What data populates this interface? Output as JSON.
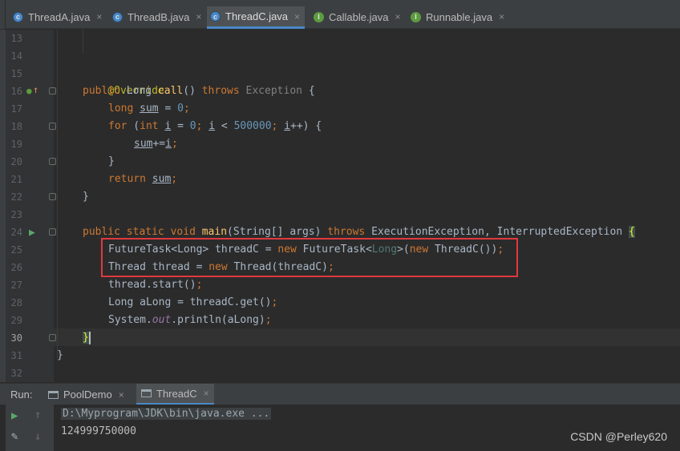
{
  "tabs": [
    {
      "label": "ThreadA.java",
      "icon": "class-icon",
      "active": false
    },
    {
      "label": "ThreadB.java",
      "icon": "class-icon",
      "active": false
    },
    {
      "label": "ThreadC.java",
      "icon": "class-icon",
      "active": true
    },
    {
      "label": "Callable.java",
      "icon": "interface-icon",
      "active": false
    },
    {
      "label": "Runnable.java",
      "icon": "interface-icon",
      "active": false
    }
  ],
  "close_glyph": "×",
  "line_numbers": [
    "13",
    "14",
    "15",
    "16",
    "17",
    "18",
    "19",
    "20",
    "21",
    "22",
    "23",
    "24",
    "25",
    "26",
    "27",
    "28",
    "29",
    "30",
    "31",
    "32"
  ],
  "current_line": "30",
  "code": {
    "annotation": "@Override",
    "public": "public",
    "long_type": "Long",
    "call": "call",
    "parens": "()",
    "throws": "throws",
    "exception": "Exception",
    "open_brace": "{",
    "long_kw": "long",
    "sum": "sum",
    "eq": " = ",
    "zero": "0",
    "semi": ";",
    "for": "for",
    "int": "int",
    "i": "i",
    "lt": " < ",
    "limit": "500000",
    "inc": "++",
    "sum_add": "+=",
    "close_brace": "}",
    "return": "return",
    "static": "static",
    "void": "void",
    "main": "main",
    "main_args": "(String[] args) ",
    "exceptions_main": "ExecutionException, InterruptedException ",
    "futuretask": "FutureTask",
    "lt_gen": "<",
    "gt_gen": ">",
    "threadc_var": " threadC = ",
    "new": "new",
    "threadc_ctor": "ThreadC()",
    "thread_decl": "Thread thread = ",
    "thread_ctor": " Thread(threadC)",
    "thread_start": "thread.start()",
    "along_decl": "Long aLong = threadC.get()",
    "system": "System.",
    "out": "out",
    "println": ".println(aLong)"
  },
  "run": {
    "label": "Run:",
    "tabs": [
      {
        "label": "PoolDemo",
        "active": false
      },
      {
        "label": "ThreadC",
        "active": true
      }
    ],
    "console_lines": [
      "D:\\Myprogram\\JDK\\bin\\java.exe ...",
      "124999750000"
    ]
  },
  "watermark": "CSDN @Perley620",
  "colors": {
    "accent": "#4a88c7",
    "highlight_box": "#e0393e",
    "keyword": "#cc7832",
    "number": "#6897bb",
    "method": "#ffc66d"
  }
}
